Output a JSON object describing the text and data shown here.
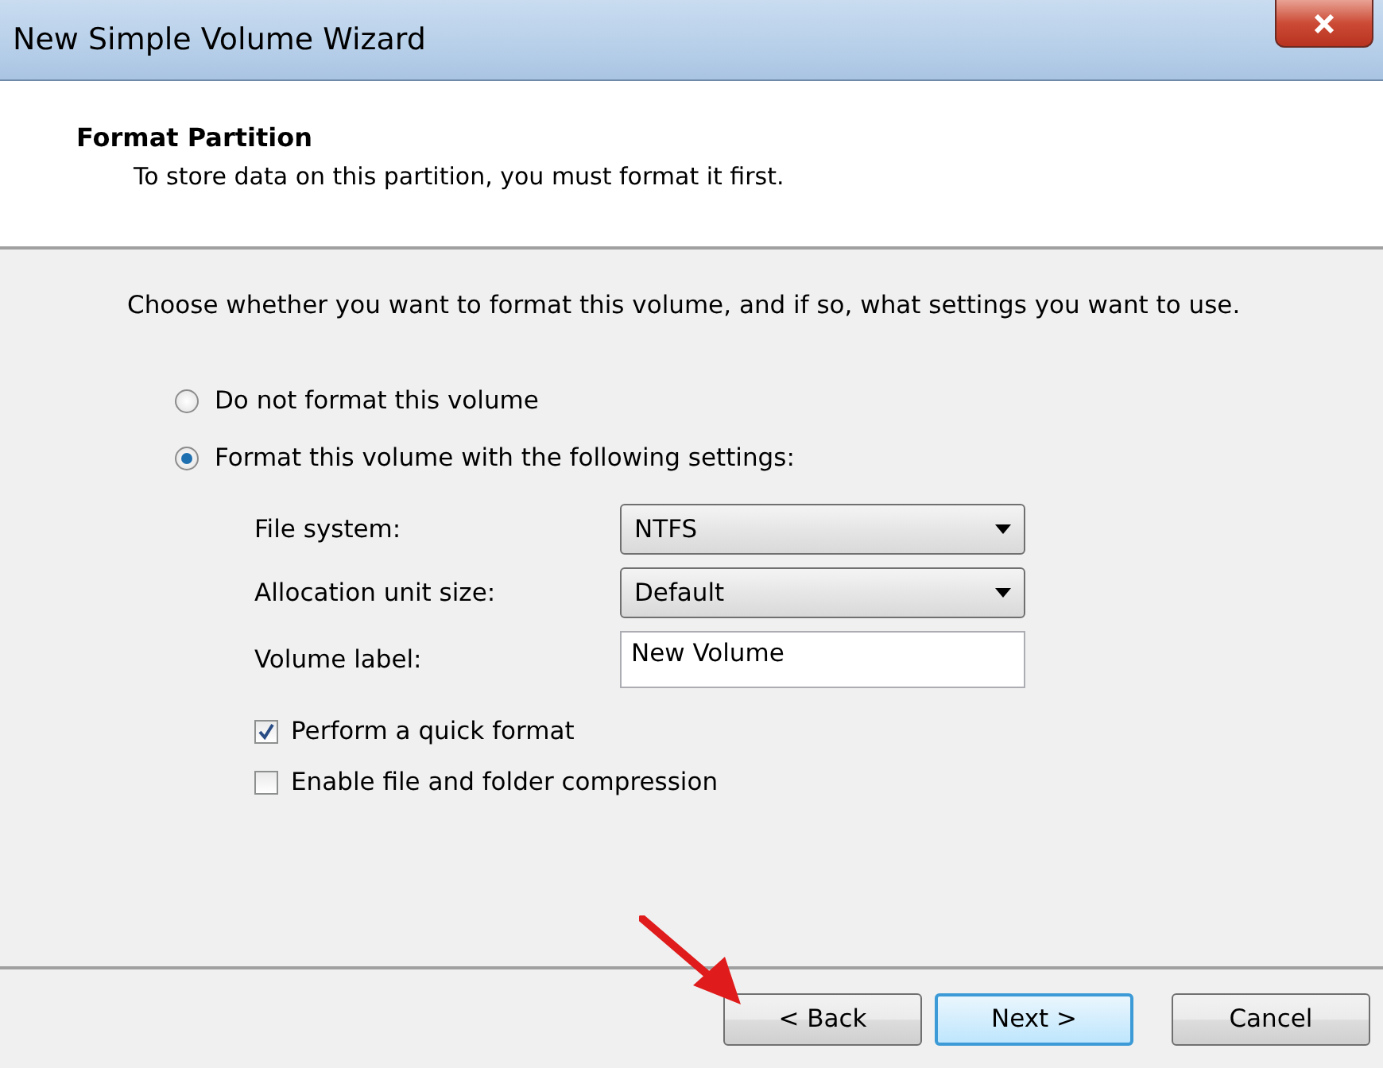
{
  "window": {
    "title": "New Simple Volume Wizard"
  },
  "header": {
    "title": "Format Partition",
    "subtitle": "To store data on this partition, you must format it first."
  },
  "intro": "Choose whether you want to format this volume, and if so, what settings you want to use.",
  "options": [
    {
      "label": "Do not format this volume",
      "selected": false
    },
    {
      "label": "Format this volume with the following settings:",
      "selected": true
    }
  ],
  "settings": [
    {
      "kind": "dropdown",
      "label": "File system:",
      "value": "NTFS"
    },
    {
      "kind": "dropdown",
      "label": "Allocation unit size:",
      "value": "Default"
    },
    {
      "kind": "text",
      "label": "Volume label:",
      "value": "New Volume"
    }
  ],
  "checkboxes": [
    {
      "label": "Perform a quick format",
      "checked": true
    },
    {
      "label": "Enable file and folder compression",
      "checked": false
    }
  ],
  "buttons": [
    {
      "label": "< Back",
      "default": false
    },
    {
      "label": "Next >",
      "default": true
    },
    {
      "label": "Cancel",
      "default": false
    }
  ]
}
